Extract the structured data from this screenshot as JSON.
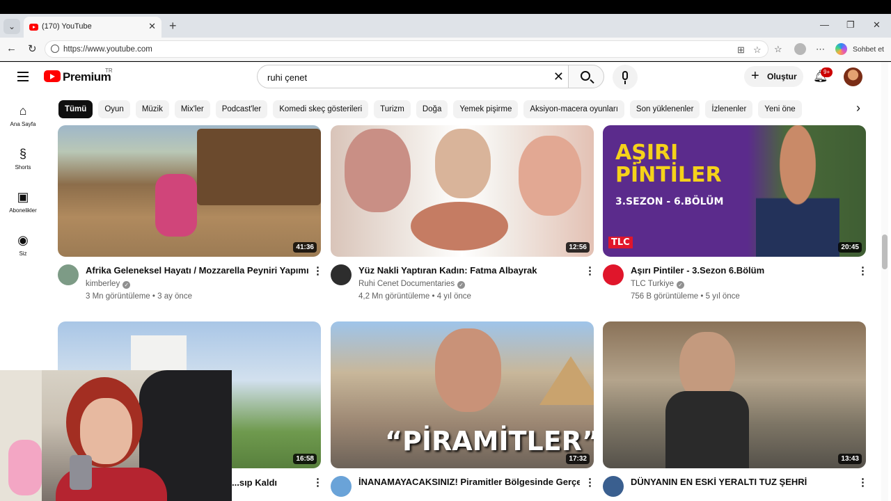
{
  "browser": {
    "tab_title": "(170) YouTube",
    "url": "https://www.youtube.com",
    "copilot_label": "Sohbet et"
  },
  "header": {
    "brand": "Premium",
    "region": "TR",
    "search_value": "ruhi çenet",
    "create_label": "Oluştur",
    "notif_badge": "9+"
  },
  "sidebar": {
    "items": [
      {
        "label": "Ana Sayfa",
        "icon": "home-icon"
      },
      {
        "label": "Shorts",
        "icon": "shorts-icon"
      },
      {
        "label": "Abonelikler",
        "icon": "subscriptions-icon"
      },
      {
        "label": "Siz",
        "icon": "you-icon"
      }
    ]
  },
  "chips": [
    "Tümü",
    "Oyun",
    "Müzik",
    "Mix'ler",
    "Podcast'ler",
    "Komedi skeç gösterileri",
    "Turizm",
    "Doğa",
    "Yemek pişirme",
    "Aksiyon-macera oyunları",
    "Son yüklenenler",
    "İzlenenler",
    "Yeni öne"
  ],
  "videos": [
    {
      "title": "Afrika Geleneksel Hayatı / Mozzarella Peyniri Yapımı",
      "channel": "kimberley",
      "meta": "3 Mn görüntüleme • 3 ay önce",
      "duration": "41:36"
    },
    {
      "title": "Yüz Nakli Yaptıran Kadın: Fatma Albayrak",
      "channel": "Ruhi Cenet Documentaries",
      "meta": "4,2 Mn görüntüleme • 4 yıl önce",
      "duration": "12:56"
    },
    {
      "title": "Aşırı Pintiler - 3.Sezon 6.Bölüm",
      "channel": "TLC Turkiye",
      "meta": "756 B görüntüleme • 5 yıl önce",
      "duration": "20:45",
      "thumb_line1": "AŞIRI",
      "thumb_line2": "PİNTİLER",
      "thumb_sub": "3.SEZON - 6.BÖLÜM",
      "thumb_logo": "TLC"
    },
    {
      "title": "...sıp Kaldı",
      "duration": "16:58"
    },
    {
      "title": "İNANAMAYACAKSINIZ! Piramitler Bölgesinde Gerçek",
      "duration": "17:32",
      "thumb_text": "“PİRAMİTLER”"
    },
    {
      "title": "DÜNYANIN EN ESKİ YERALTI TUZ ŞEHRİ",
      "duration": "13:43"
    }
  ],
  "colors": {
    "brand_red": "#ff0000",
    "chip_active": "#0f0f0f",
    "tlc_purple": "#5b2b8c"
  }
}
